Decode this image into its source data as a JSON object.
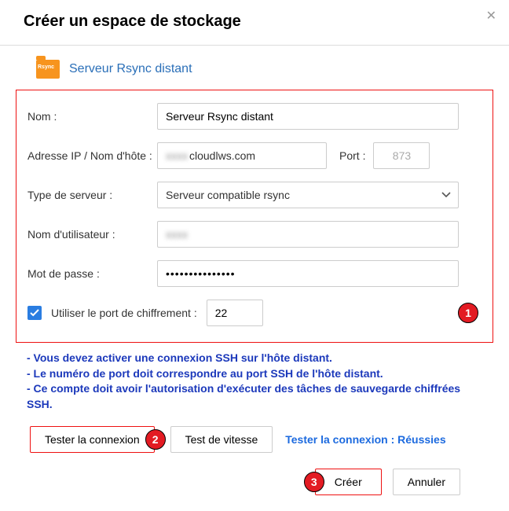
{
  "header": {
    "title": "Créer un espace de stockage"
  },
  "section": {
    "title": "Serveur Rsync distant"
  },
  "form": {
    "name_label": "Nom :",
    "name_value": "Serveur Rsync distant",
    "ip_label": "Adresse IP / Nom d'hôte :",
    "ip_prefix": "xxxx",
    "ip_value": "cloudlws.com",
    "port_label": "Port :",
    "port_value": "873",
    "server_type_label": "Type de serveur :",
    "server_type_value": "Serveur compatible rsync",
    "username_label": "Nom d'utilisateur :",
    "username_hidden": "xxxx",
    "password_label": "Mot de passe :",
    "password_dots": "•••••••••••••••",
    "enc_checkbox_label": "Utiliser le port de chiffrement :",
    "enc_port_value": "22"
  },
  "hints": {
    "l1": "- Vous devez activer une connexion SSH sur l'hôte distant.",
    "l2": "- Le numéro de port doit correspondre au port SSH de l'hôte distant.",
    "l3": "- Ce compte doit avoir l'autorisation d'exécuter des tâches de sauvegarde chiffrées SSH."
  },
  "buttons": {
    "test_conn": "Tester la connexion",
    "test_speed": "Test de vitesse",
    "test_result": "Tester la connexion : Réussies",
    "create": "Créer",
    "cancel": "Annuler"
  },
  "markers": {
    "m1": "1",
    "m2": "2",
    "m3": "3"
  }
}
